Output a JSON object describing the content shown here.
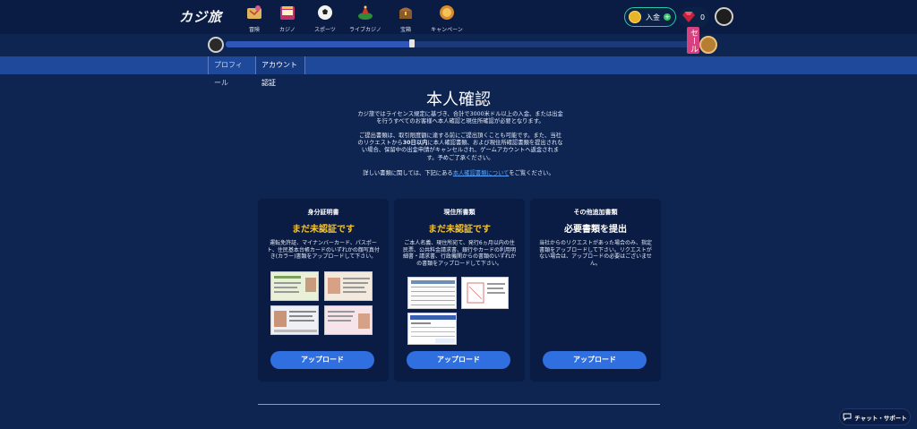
{
  "header": {
    "logo": "カジ旅",
    "nav": [
      {
        "label": "冒険",
        "icon": "map-icon"
      },
      {
        "label": "カジノ",
        "icon": "slot-machine-icon"
      },
      {
        "label": "スポーツ",
        "icon": "soccer-ball-icon"
      },
      {
        "label": "ライブカジノ",
        "icon": "roulette-icon"
      },
      {
        "label": "宝箱",
        "icon": "treasure-chest-icon"
      },
      {
        "label": "キャンペーン",
        "icon": "campaign-medal-icon"
      }
    ],
    "deposit_label": "入金",
    "gem_count": "0"
  },
  "progress": {
    "fraction": 0.39,
    "sale_label": "セール"
  },
  "tabs": [
    {
      "label": "プロフィール"
    },
    {
      "label": "アカウント認証"
    }
  ],
  "main": {
    "title": "本人確認",
    "para1": "カジ旅ではライセンス規定に基づき、合計で3000米ドル以上の入金、または出金を行うすべてのお客様へ本人確認と現住所確認が必要となります。",
    "para2_a": "ご提出書類は、取引限度額に達する前にご提出頂くことも可能です。また、当社のリクエストから",
    "para2_em": "30日以内",
    "para2_b": "に本人確認書類、および現住所確認書類を提出されない場合、保留中の出金申請がキャンセルされ、ゲームアカウントへ返金されます。予めご了承ください。",
    "para3_a": "詳しい書類に関しては、下記にある",
    "para3_link": "本人確認書類について",
    "para3_b": "をご覧ください。"
  },
  "cards": [
    {
      "heading": "身分証明書",
      "status": "まだ未認証です",
      "desc": "運転免許証、マイナンバーカード、パスポート、住民基本台帳カードのいずれかの顔写真付き(カラー)書類をアップロードして下さい。",
      "button": "アップロード"
    },
    {
      "heading": "現住所書類",
      "status": "まだ未認証です",
      "desc": "ご本人名義、現住所宛て、発行6ヵ月以内の住民票、公共料金請求書、銀行やカードの利用明細書・請求書、行政機関からの書類のいずれかの書類をアップロードして下さい。",
      "button": "アップロード"
    },
    {
      "heading": "その他追加書類",
      "status": "必要書類を提出",
      "desc": "当社からのリクエストがあった場合のみ、指定書類をアップロードして下さい。リクエストがない場合は、アップロードの必要はございません。",
      "button": "アップロード"
    }
  ],
  "chat_label": "チャット・サポート",
  "colors": {
    "background": "#0e2451",
    "header": "#0a1c44",
    "tabbar": "#1f4a9c",
    "status_yellow": "#f5c433",
    "button_blue": "#2f6fe0",
    "link": "#58a6ff"
  }
}
